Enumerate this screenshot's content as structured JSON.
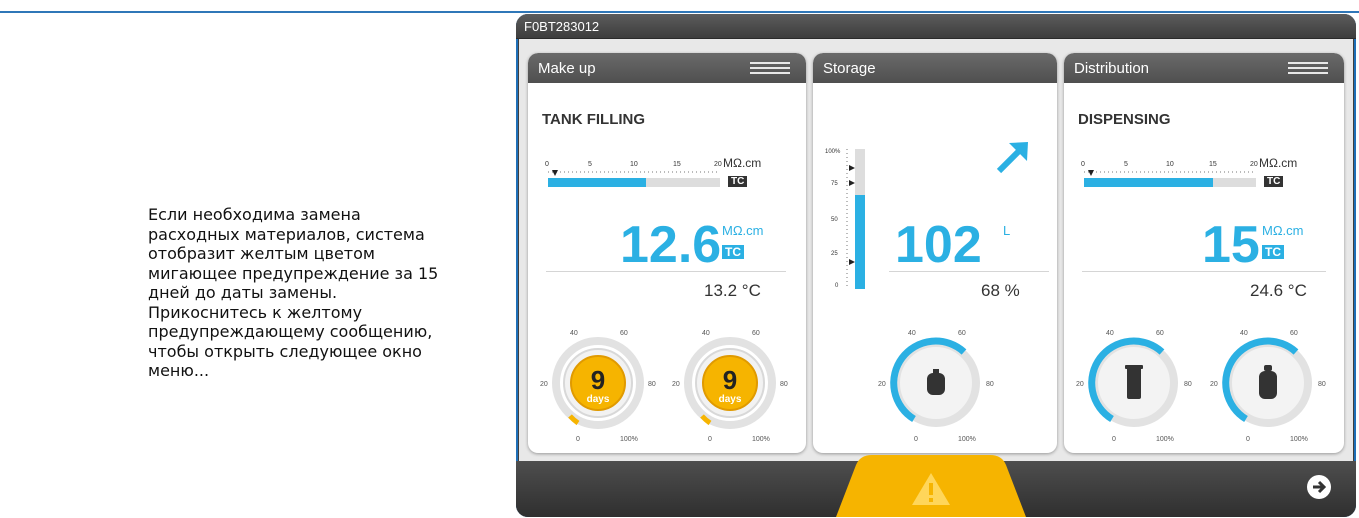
{
  "instruction_text": "Если необходима замена расходных материалов, система отобразит желтым цветом мигающее предупреждение за 15 дней до даты замены. Прикоснитесь к желтому предупреждающему сообщению, чтобы открыть следующее окно меню...",
  "device": {
    "serial": "F0BT283012",
    "colors": {
      "accent": "#2bb0e3",
      "warning": "#f6b400",
      "header": "#555555",
      "frame_border": "#1f6fb7"
    }
  },
  "panels": {
    "makeup": {
      "title": "Make up",
      "section_title": "TANK FILLING",
      "scale_ticks": [
        "0",
        "5",
        "10",
        "15",
        "20"
      ],
      "scale_unit": "MΩ.cm",
      "scale_badge": "TC",
      "scale_fill_fraction": 0.57,
      "value": "12.6",
      "value_unit": "MΩ.cm",
      "value_badge": "TC",
      "temperature": "13.2 °C",
      "dials": [
        {
          "value": "9",
          "label": "days",
          "ticks": [
            "40",
            "60",
            "80",
            "100%",
            "0",
            "20"
          ],
          "icon": "hourglass-days-icon"
        },
        {
          "value": "9",
          "label": "days",
          "ticks": [
            "40",
            "60",
            "80",
            "100%",
            "0",
            "20"
          ],
          "icon": "hourglass-days-icon"
        }
      ]
    },
    "storage": {
      "title": "Storage",
      "level_ticks": [
        "100%",
        "75",
        "50",
        "25",
        "0"
      ],
      "level_fraction": 0.68,
      "trend_icon": "arrow-up-right-icon",
      "value": "102",
      "value_unit": "L",
      "percent": "68 %",
      "dial": {
        "ticks": [
          "40",
          "60",
          "80",
          "100%",
          "0",
          "20"
        ],
        "icon": "filter-tank-icon",
        "fill_fraction": 0.7
      }
    },
    "distribution": {
      "title": "Distribution",
      "section_title": "DISPENSING",
      "scale_ticks": [
        "0",
        "5",
        "10",
        "15",
        "20"
      ],
      "scale_unit": "MΩ.cm",
      "scale_badge": "TC",
      "scale_fill_fraction": 0.75,
      "value": "15",
      "value_unit": "MΩ.cm",
      "value_badge": "TC",
      "temperature": "24.6 °C",
      "dials": [
        {
          "ticks": [
            "40",
            "60",
            "80",
            "100%",
            "0",
            "20"
          ],
          "icon": "cartridge-icon",
          "fill_fraction": 0.65
        },
        {
          "ticks": [
            "40",
            "60",
            "80",
            "100%",
            "0",
            "20"
          ],
          "icon": "filter-bottle-icon",
          "fill_fraction": 0.65
        }
      ]
    }
  },
  "footer": {
    "alert_icon": "warning-triangle-icon",
    "next_icon": "arrow-right-circle-icon"
  }
}
